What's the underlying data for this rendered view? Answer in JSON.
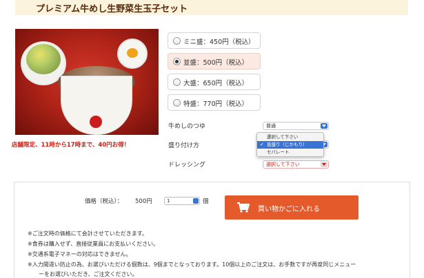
{
  "product": {
    "title": "プレミアム牛めし生野菜生玉子セット",
    "promo": "店舗限定、11時から17時まで、40円お得！"
  },
  "sizes": [
    {
      "label": "ミニ盛：450円（税込）",
      "selected": false
    },
    {
      "label": "並盛：500円（税込）",
      "selected": true
    },
    {
      "label": "大盛：650円（税込）",
      "selected": false
    },
    {
      "label": "特盛：770円（税込）",
      "selected": false
    }
  ],
  "options": {
    "tsuyu": {
      "label": "牛めしのつゆ",
      "value": "普通"
    },
    "serving": {
      "label": "盛り付け方",
      "dropdown": [
        "選択して下さい",
        "直盛り（じかもり）",
        "セパレート"
      ],
      "active_index": 1
    },
    "dressing": {
      "label": "ドレッシング",
      "value": "選択して下さい"
    }
  },
  "order": {
    "price_label": "価格（税込）：",
    "price_value": "500円",
    "quantity": "1",
    "quantity_unit": "個",
    "cart_button": "買い物かごに入れる"
  },
  "notes": [
    "※ご注文時の価格にて会計させていただきます。",
    "※食券は購入せず、直接従業員にお支払いください。",
    "※交通系電子マネーの対応はできません。",
    "※入力間違い防止の為、お選びいただける個数は、9個までとなっております。10個以上のご注文は、お手数ですが再度同じメニュー",
    "ーをお選びいただき、ご注文ください。"
  ],
  "colors": {
    "accent": "#e55a2b",
    "promo": "#cc1c12",
    "title_bg": "#fbf3dc",
    "selected_bg": "#fbe9e2"
  }
}
